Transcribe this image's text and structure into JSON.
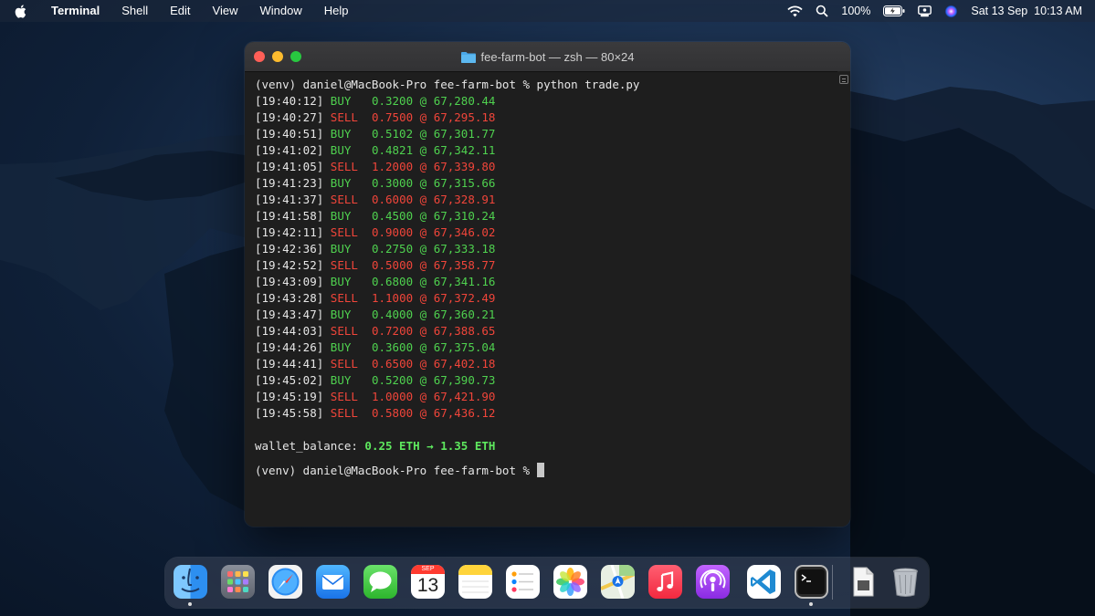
{
  "menubar": {
    "app_name": "Terminal",
    "items": [
      "Shell",
      "Edit",
      "View",
      "Window",
      "Help"
    ],
    "battery": "100%",
    "datetime": "Sat 13 Sep  10:13 AM"
  },
  "window": {
    "title": "fee-farm-bot — zsh — 80×24",
    "first_command": "(venv) daniel@MacBook-Pro fee-farm-bot % python trade.py",
    "trades": [
      {
        "time": "[19:40:12]",
        "side": "BUY",
        "qty": "0.3200",
        "price": "67,280.44"
      },
      {
        "time": "[19:40:27]",
        "side": "SELL",
        "qty": "0.7500",
        "price": "67,295.18"
      },
      {
        "time": "[19:40:51]",
        "side": "BUY",
        "qty": "0.5102",
        "price": "67,301.77"
      },
      {
        "time": "[19:41:02]",
        "side": "BUY",
        "qty": "0.4821",
        "price": "67,342.11"
      },
      {
        "time": "[19:41:05]",
        "side": "SELL",
        "qty": "1.2000",
        "price": "67,339.80"
      },
      {
        "time": "[19:41:23]",
        "side": "BUY",
        "qty": "0.3000",
        "price": "67,315.66"
      },
      {
        "time": "[19:41:37]",
        "side": "SELL",
        "qty": "0.6000",
        "price": "67,328.91"
      },
      {
        "time": "[19:41:58]",
        "side": "BUY",
        "qty": "0.4500",
        "price": "67,310.24"
      },
      {
        "time": "[19:42:11]",
        "side": "SELL",
        "qty": "0.9000",
        "price": "67,346.02"
      },
      {
        "time": "[19:42:36]",
        "side": "BUY",
        "qty": "0.2750",
        "price": "67,333.18"
      },
      {
        "time": "[19:42:52]",
        "side": "SELL",
        "qty": "0.5000",
        "price": "67,358.77"
      },
      {
        "time": "[19:43:09]",
        "side": "BUY",
        "qty": "0.6800",
        "price": "67,341.16"
      },
      {
        "time": "[19:43:28]",
        "side": "SELL",
        "qty": "1.1000",
        "price": "67,372.49"
      },
      {
        "time": "[19:43:47]",
        "side": "BUY",
        "qty": "0.4000",
        "price": "67,360.21"
      },
      {
        "time": "[19:44:03]",
        "side": "SELL",
        "qty": "0.7200",
        "price": "67,388.65"
      },
      {
        "time": "[19:44:26]",
        "side": "BUY",
        "qty": "0.3600",
        "price": "67,375.04"
      },
      {
        "time": "[19:44:41]",
        "side": "SELL",
        "qty": "0.6500",
        "price": "67,402.18"
      },
      {
        "time": "[19:45:02]",
        "side": "BUY",
        "qty": "0.5200",
        "price": "67,390.73"
      },
      {
        "time": "[19:45:19]",
        "side": "SELL",
        "qty": "1.0000",
        "price": "67,421.90"
      },
      {
        "time": "[19:45:58]",
        "side": "SELL",
        "qty": "0.5800",
        "price": "67,436.12"
      }
    ],
    "wallet_label": "wallet_balance:",
    "wallet_value": "0.25 ETH → 1.35 ETH",
    "prompt": "(venv) daniel@MacBook-Pro fee-farm-bot %"
  },
  "dock": {
    "apps": [
      "finder",
      "launchpad",
      "safari",
      "mail",
      "messages",
      "calendar",
      "notes",
      "reminders",
      "photos",
      "maps",
      "music",
      "podcasts",
      "vscode",
      "terminal",
      "document",
      "trash"
    ],
    "calendar_month": "SEP",
    "calendar_day": "13"
  },
  "colors": {
    "buy": "#4fd14f",
    "sell": "#f0453a",
    "wallet": "#5ee85e"
  }
}
